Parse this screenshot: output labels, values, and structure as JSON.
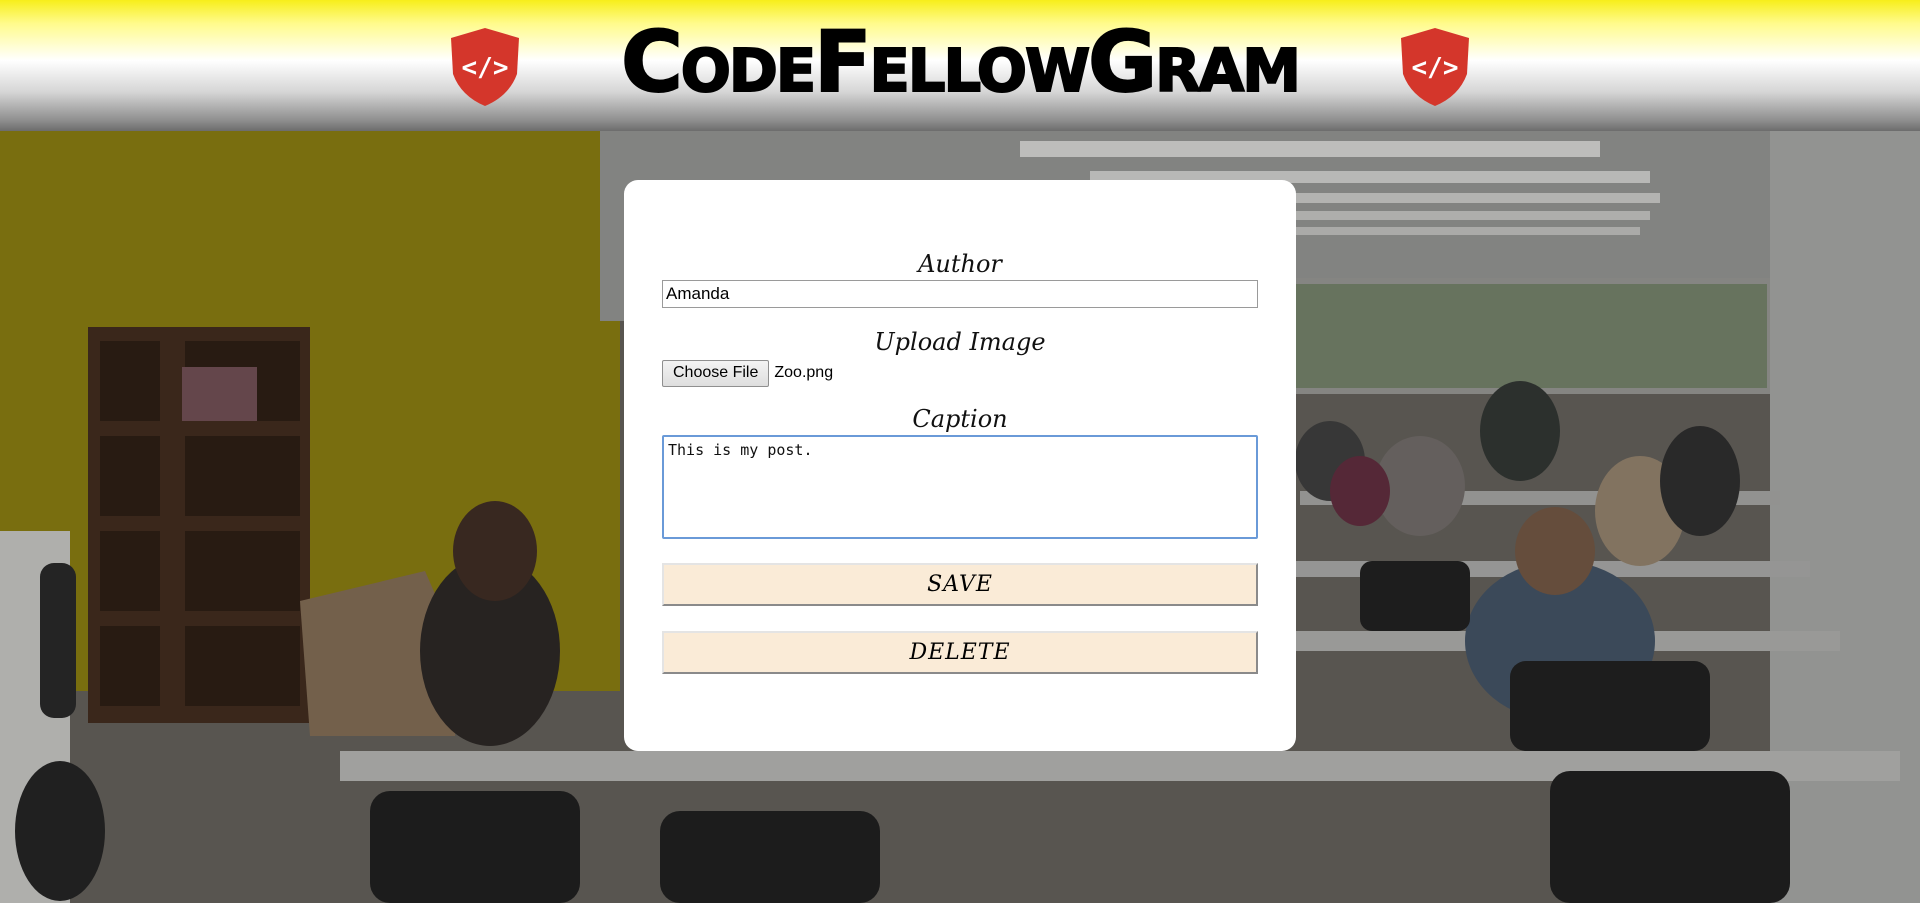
{
  "header": {
    "title": "CodeFellowGram",
    "logo_icon": "code-shield-icon",
    "logo_color": "#d4362b"
  },
  "form": {
    "author_label": "Author",
    "author_value": "Amanda",
    "upload_label": "Upload Image",
    "choose_file_label": "Choose File",
    "file_name": "Zoo.png",
    "caption_label": "Caption",
    "caption_value": "This is my post.",
    "save_label": "SAVE",
    "delete_label": "DELETE",
    "button_color": "#faebd7",
    "focus_color": "#6a9ad8"
  },
  "background": {
    "description_icon": "office-photo"
  }
}
